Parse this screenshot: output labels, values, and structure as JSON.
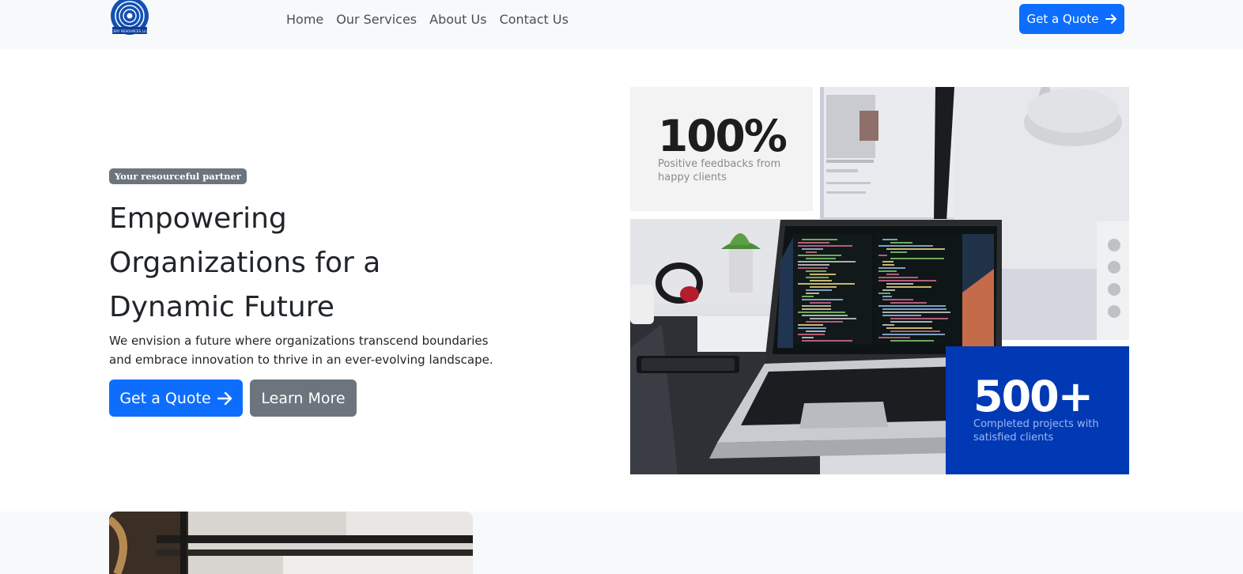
{
  "navbar": {
    "logo_text": "CERY RESOURCES LLC",
    "links": [
      "Home",
      "Our Services",
      "About Us",
      "Contact Us"
    ],
    "quote_button": "Get a Quote"
  },
  "hero": {
    "badge": "Your resourceful partner",
    "title": "Empowering Organizations for a Dynamic Future",
    "description": "We envision a future where organizations transcend boundaries and embrace innovation to thrive in an ever-evolving landscape.",
    "primary_button": "Get a Quote",
    "secondary_button": "Learn More"
  },
  "stats": [
    {
      "number": "100%",
      "text": "Positive feedbacks from happy clients"
    },
    {
      "number": "500+",
      "text": "Completed projects with satisfied clients"
    }
  ],
  "colors": {
    "primary": "#0d6efd",
    "secondary": "#6c757d",
    "stat_blue": "#0039b3",
    "navbar_bg": "#f8f9fa"
  },
  "icons": {
    "arrow": "arrow-right-icon",
    "logo": "logo-emblem"
  }
}
